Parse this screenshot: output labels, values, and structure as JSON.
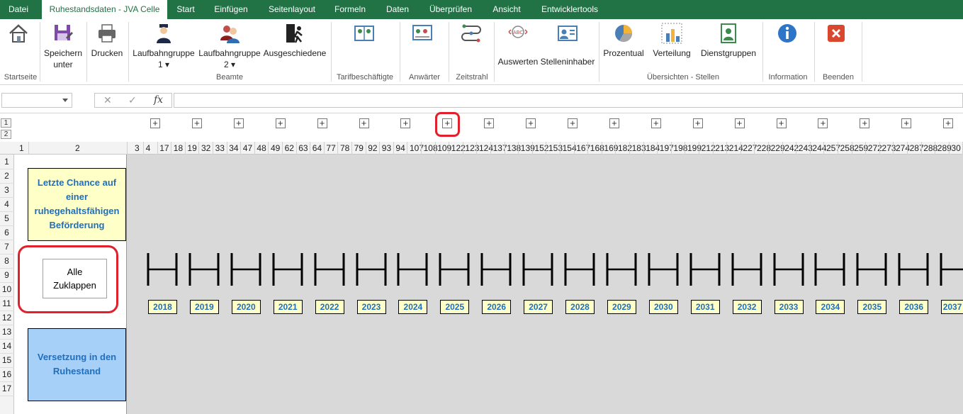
{
  "menu": {
    "tabs": [
      "Datei",
      "Ruhestandsdaten - JVA Celle",
      "Start",
      "Einfügen",
      "Seitenlayout",
      "Formeln",
      "Daten",
      "Überprüfen",
      "Ansicht",
      "Entwicklertools"
    ],
    "active": "Ruhestandsdaten - JVA Celle"
  },
  "ribbon": {
    "buttons": {
      "home": "",
      "save_as_1": "Speichern",
      "save_as_2": "unter",
      "print": "Drucken",
      "lg1_1": "Laufbahngruppe",
      "lg1_2": "1 ▾",
      "lg2_1": "Laufbahngruppe",
      "lg2_2": "2 ▾",
      "retired": "Ausgeschiedene",
      "evaluate": "Auswerten",
      "holder": "Stelleninhaber",
      "percent": "Prozentual",
      "distribution": "Verteilung",
      "groups": "Dienstgruppen"
    },
    "groups": {
      "start": "Startseite",
      "beamte": "Beamte",
      "tarif": "Tarifbeschäftigte",
      "anwaerter": "Anwärter",
      "zeitstrahl": "Zeitstrahl",
      "uebersichten": "Übersichten - Stellen",
      "information": "Information",
      "beenden": "Beenden"
    }
  },
  "formula_bar": {
    "cancel": "✕",
    "enter": "✓",
    "fx": "fx"
  },
  "outline": {
    "levels": [
      "1",
      "2"
    ],
    "plus": "+"
  },
  "columns": [
    "1",
    "2",
    "3",
    "4",
    "17",
    "18",
    "19",
    "32",
    "33",
    "34",
    "47",
    "48",
    "49",
    "62",
    "63",
    "64",
    "77",
    "78",
    "79",
    "92",
    "93",
    "94",
    "107",
    "108",
    "109",
    "122",
    "123",
    "124",
    "137",
    "138",
    "139",
    "152",
    "153",
    "154",
    "167",
    "168",
    "169",
    "182",
    "183",
    "184",
    "197",
    "198",
    "199",
    "212",
    "213",
    "214",
    "227",
    "228",
    "229",
    "242",
    "243",
    "244",
    "257",
    "258",
    "259",
    "272",
    "273",
    "274",
    "287",
    "288",
    "289",
    "30"
  ],
  "rows": [
    "1",
    "2",
    "3",
    "4",
    "5",
    "6",
    "7",
    "8",
    "9",
    "10",
    "11",
    "12",
    "13",
    "14",
    "15",
    "16",
    "17"
  ],
  "sheet": {
    "box_top": [
      "Letzte Chance auf",
      "einer",
      "ruhegehaltsfähigen",
      "Beförderung"
    ],
    "collapse_button": [
      "Alle",
      "Zuklappen"
    ],
    "box_bottom": [
      "Versetzung in den",
      "Ruhestand"
    ],
    "years": [
      "2018",
      "2019",
      "2020",
      "2021",
      "2022",
      "2023",
      "2024",
      "2025",
      "2026",
      "2027",
      "2028",
      "2029",
      "2030",
      "2031",
      "2032",
      "2033",
      "2034",
      "2035",
      "2036",
      "2037"
    ]
  },
  "colors": {
    "excel_green": "#217346",
    "label_blue": "#1f6fbf",
    "yellow_fill": "#ffffc8",
    "blue_fill": "#a6d0f7",
    "highlight_red": "#e0202a"
  }
}
